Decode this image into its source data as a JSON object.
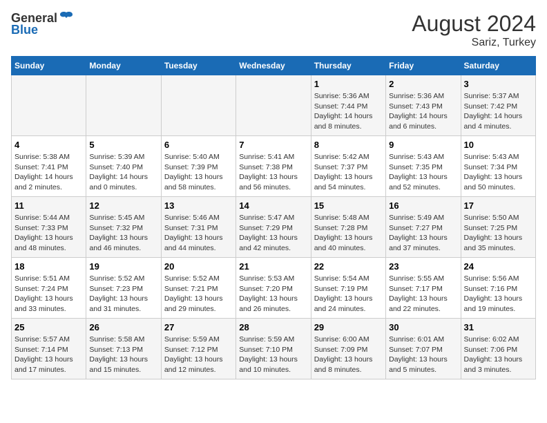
{
  "header": {
    "logo_general": "General",
    "logo_blue": "Blue",
    "month_title": "August 2024",
    "location": "Sariz, Turkey"
  },
  "days_of_week": [
    "Sunday",
    "Monday",
    "Tuesday",
    "Wednesday",
    "Thursday",
    "Friday",
    "Saturday"
  ],
  "weeks": [
    [
      {
        "day": "",
        "info": ""
      },
      {
        "day": "",
        "info": ""
      },
      {
        "day": "",
        "info": ""
      },
      {
        "day": "",
        "info": ""
      },
      {
        "day": "1",
        "info": "Sunrise: 5:36 AM\nSunset: 7:44 PM\nDaylight: 14 hours\nand 8 minutes."
      },
      {
        "day": "2",
        "info": "Sunrise: 5:36 AM\nSunset: 7:43 PM\nDaylight: 14 hours\nand 6 minutes."
      },
      {
        "day": "3",
        "info": "Sunrise: 5:37 AM\nSunset: 7:42 PM\nDaylight: 14 hours\nand 4 minutes."
      }
    ],
    [
      {
        "day": "4",
        "info": "Sunrise: 5:38 AM\nSunset: 7:41 PM\nDaylight: 14 hours\nand 2 minutes."
      },
      {
        "day": "5",
        "info": "Sunrise: 5:39 AM\nSunset: 7:40 PM\nDaylight: 14 hours\nand 0 minutes."
      },
      {
        "day": "6",
        "info": "Sunrise: 5:40 AM\nSunset: 7:39 PM\nDaylight: 13 hours\nand 58 minutes."
      },
      {
        "day": "7",
        "info": "Sunrise: 5:41 AM\nSunset: 7:38 PM\nDaylight: 13 hours\nand 56 minutes."
      },
      {
        "day": "8",
        "info": "Sunrise: 5:42 AM\nSunset: 7:37 PM\nDaylight: 13 hours\nand 54 minutes."
      },
      {
        "day": "9",
        "info": "Sunrise: 5:43 AM\nSunset: 7:35 PM\nDaylight: 13 hours\nand 52 minutes."
      },
      {
        "day": "10",
        "info": "Sunrise: 5:43 AM\nSunset: 7:34 PM\nDaylight: 13 hours\nand 50 minutes."
      }
    ],
    [
      {
        "day": "11",
        "info": "Sunrise: 5:44 AM\nSunset: 7:33 PM\nDaylight: 13 hours\nand 48 minutes."
      },
      {
        "day": "12",
        "info": "Sunrise: 5:45 AM\nSunset: 7:32 PM\nDaylight: 13 hours\nand 46 minutes."
      },
      {
        "day": "13",
        "info": "Sunrise: 5:46 AM\nSunset: 7:31 PM\nDaylight: 13 hours\nand 44 minutes."
      },
      {
        "day": "14",
        "info": "Sunrise: 5:47 AM\nSunset: 7:29 PM\nDaylight: 13 hours\nand 42 minutes."
      },
      {
        "day": "15",
        "info": "Sunrise: 5:48 AM\nSunset: 7:28 PM\nDaylight: 13 hours\nand 40 minutes."
      },
      {
        "day": "16",
        "info": "Sunrise: 5:49 AM\nSunset: 7:27 PM\nDaylight: 13 hours\nand 37 minutes."
      },
      {
        "day": "17",
        "info": "Sunrise: 5:50 AM\nSunset: 7:25 PM\nDaylight: 13 hours\nand 35 minutes."
      }
    ],
    [
      {
        "day": "18",
        "info": "Sunrise: 5:51 AM\nSunset: 7:24 PM\nDaylight: 13 hours\nand 33 minutes."
      },
      {
        "day": "19",
        "info": "Sunrise: 5:52 AM\nSunset: 7:23 PM\nDaylight: 13 hours\nand 31 minutes."
      },
      {
        "day": "20",
        "info": "Sunrise: 5:52 AM\nSunset: 7:21 PM\nDaylight: 13 hours\nand 29 minutes."
      },
      {
        "day": "21",
        "info": "Sunrise: 5:53 AM\nSunset: 7:20 PM\nDaylight: 13 hours\nand 26 minutes."
      },
      {
        "day": "22",
        "info": "Sunrise: 5:54 AM\nSunset: 7:19 PM\nDaylight: 13 hours\nand 24 minutes."
      },
      {
        "day": "23",
        "info": "Sunrise: 5:55 AM\nSunset: 7:17 PM\nDaylight: 13 hours\nand 22 minutes."
      },
      {
        "day": "24",
        "info": "Sunrise: 5:56 AM\nSunset: 7:16 PM\nDaylight: 13 hours\nand 19 minutes."
      }
    ],
    [
      {
        "day": "25",
        "info": "Sunrise: 5:57 AM\nSunset: 7:14 PM\nDaylight: 13 hours\nand 17 minutes."
      },
      {
        "day": "26",
        "info": "Sunrise: 5:58 AM\nSunset: 7:13 PM\nDaylight: 13 hours\nand 15 minutes."
      },
      {
        "day": "27",
        "info": "Sunrise: 5:59 AM\nSunset: 7:12 PM\nDaylight: 13 hours\nand 12 minutes."
      },
      {
        "day": "28",
        "info": "Sunrise: 5:59 AM\nSunset: 7:10 PM\nDaylight: 13 hours\nand 10 minutes."
      },
      {
        "day": "29",
        "info": "Sunrise: 6:00 AM\nSunset: 7:09 PM\nDaylight: 13 hours\nand 8 minutes."
      },
      {
        "day": "30",
        "info": "Sunrise: 6:01 AM\nSunset: 7:07 PM\nDaylight: 13 hours\nand 5 minutes."
      },
      {
        "day": "31",
        "info": "Sunrise: 6:02 AM\nSunset: 7:06 PM\nDaylight: 13 hours\nand 3 minutes."
      }
    ]
  ]
}
